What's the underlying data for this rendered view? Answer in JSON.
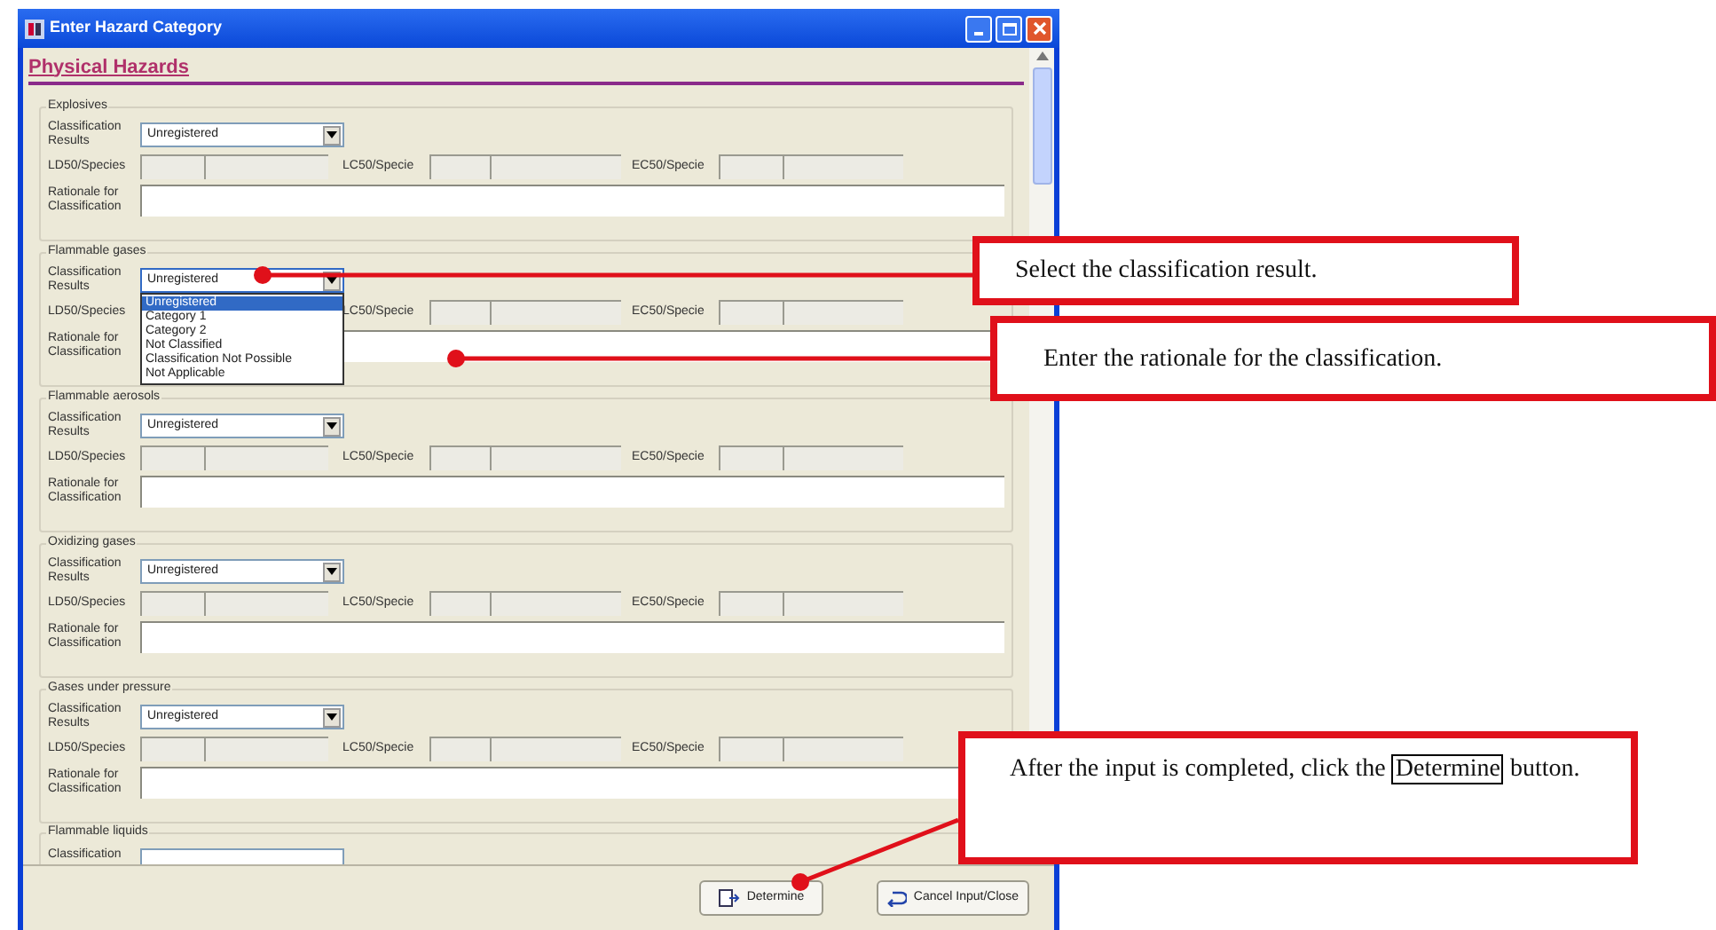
{
  "window": {
    "title": "Enter Hazard Category"
  },
  "heading": "Physical Hazards",
  "sections": [
    {
      "legend": "Explosives",
      "kind": "full",
      "labels": {
        "classification": "Classification Results",
        "ld50": "LD50/Species",
        "lc50": "LC50/Specie",
        "ec50": "EC50/Specie",
        "rationale": "Rationale for Classification"
      },
      "result": "Unregistered",
      "open": false
    },
    {
      "legend": "Flammable gases",
      "kind": "full",
      "labels": {
        "classification": "Classification Results",
        "ld50": "LD50/Species",
        "lc50": "LC50/Specie",
        "ec50": "EC50/Specie",
        "rationale": "Rationale for Classification"
      },
      "result": "Unregistered",
      "open": true,
      "options": [
        {
          "label": "Unregistered",
          "selected": true
        },
        {
          "label": "Category 1",
          "selected": false
        },
        {
          "label": "Category 2",
          "selected": false
        },
        {
          "label": "Not Classified",
          "selected": false
        },
        {
          "label": "Classification Not Possible",
          "selected": false
        },
        {
          "label": "Not Applicable",
          "selected": false
        }
      ]
    },
    {
      "legend": "Flammable aerosols",
      "kind": "full",
      "labels": {
        "classification": "Classification Results",
        "ld50": "LD50/Species",
        "lc50": "LC50/Specie",
        "ec50": "EC50/Specie",
        "rationale": "Rationale for Classification"
      },
      "result": "Unregistered",
      "open": false
    },
    {
      "legend": "Oxidizing gases",
      "kind": "full",
      "labels": {
        "classification": "Classification Results",
        "ld50": "LD50/Species",
        "lc50": "LC50/Specie",
        "ec50": "EC50/Specie",
        "rationale": "Rationale for Classification"
      },
      "result": "Unregistered",
      "open": false
    },
    {
      "legend": "Gases under pressure",
      "kind": "full",
      "labels": {
        "classification": "Classification Results",
        "ld50": "LD50/Species",
        "lc50": "LC50/Specie",
        "ec50": "EC50/Specie",
        "rationale": "Rationale for Classification"
      },
      "result": "Unregistered",
      "open": false
    },
    {
      "legend": "Flammable liquids",
      "kind": "cut",
      "label": "Classification"
    }
  ],
  "buttons": [
    {
      "label": "Determine",
      "kind": "determine"
    },
    {
      "label": "Cancel Input/Close",
      "kind": "cancel"
    }
  ],
  "callouts": [
    {
      "kind": "plain",
      "text": "Select the classification result."
    },
    {
      "kind": "plain",
      "text": "Enter the rationale for the classification."
    },
    {
      "kind": "button_ref",
      "text": "After the input is completed, click the",
      "button_name": "Determine",
      "text_after": "button."
    }
  ]
}
